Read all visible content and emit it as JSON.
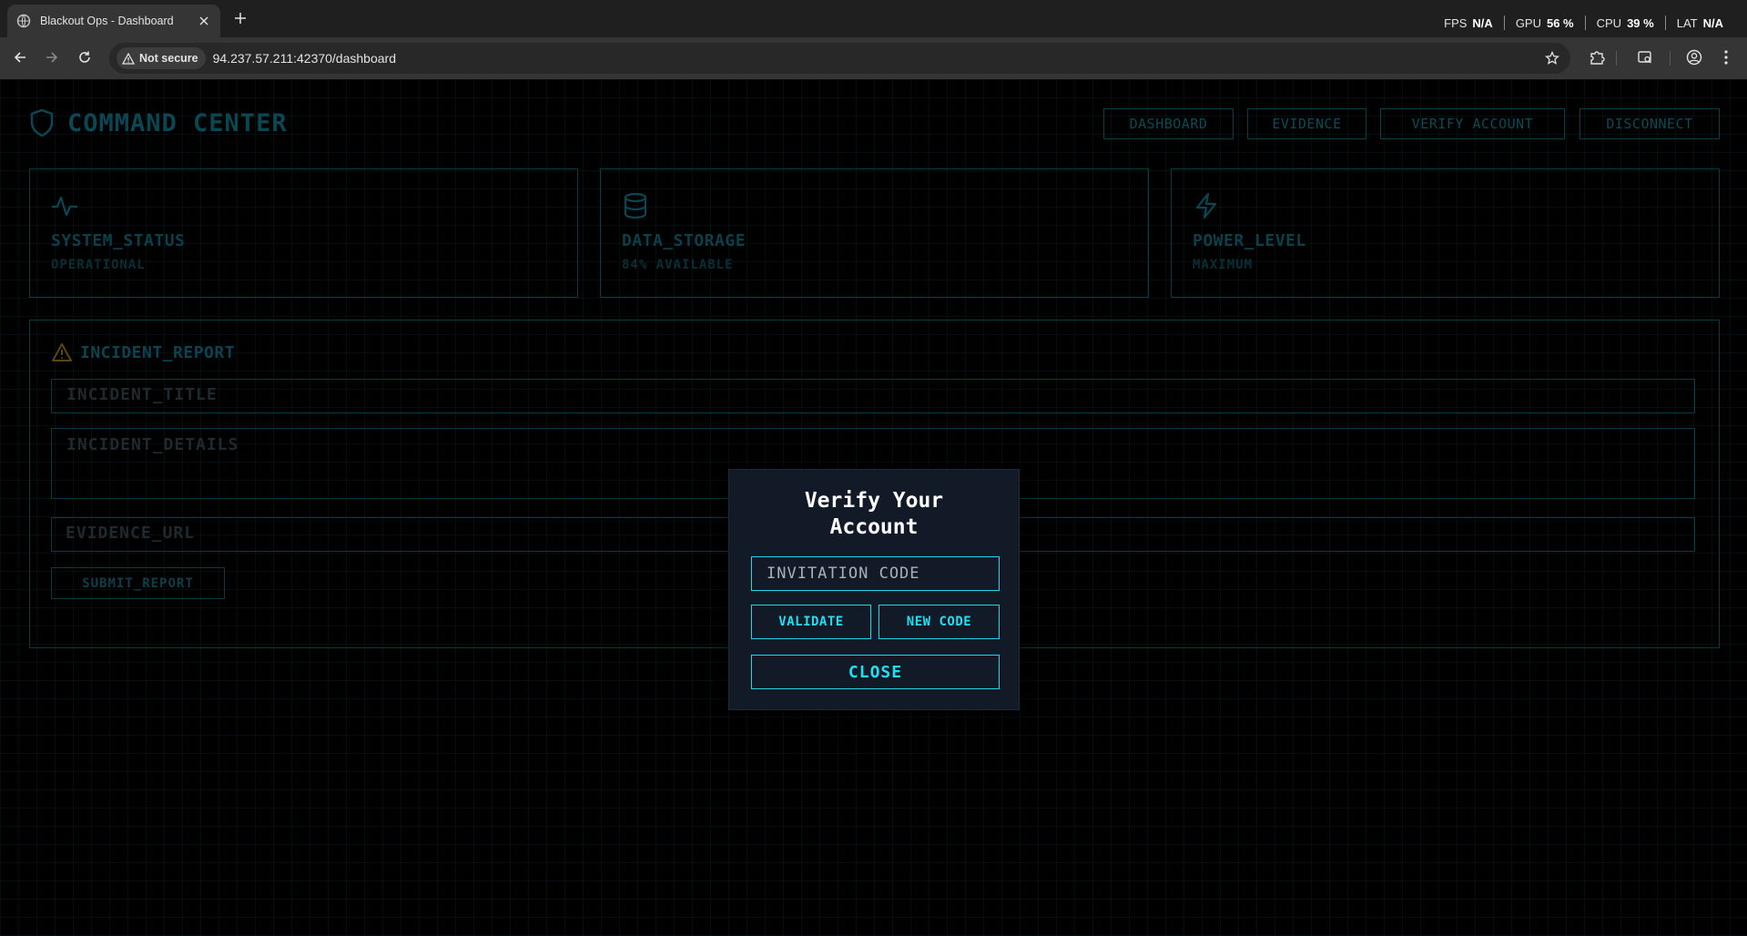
{
  "browser": {
    "tab_title": "Blackout Ops - Dashboard",
    "security_label": "Not secure",
    "url": "94.237.57.211:42370/dashboard",
    "perf": [
      {
        "label": "FPS",
        "value": "N/A"
      },
      {
        "label": "GPU",
        "value": "56 %"
      },
      {
        "label": "CPU",
        "value": "39 %"
      },
      {
        "label": "LAT",
        "value": "N/A"
      }
    ]
  },
  "header": {
    "brand": "COMMAND CENTER",
    "nav": [
      "DASHBOARD",
      "EVIDENCE",
      "VERIFY ACCOUNT",
      "DISCONNECT"
    ]
  },
  "cards": [
    {
      "icon": "activity-icon",
      "title": "SYSTEM_STATUS",
      "subtitle": "OPERATIONAL"
    },
    {
      "icon": "database-icon",
      "title": "DATA_STORAGE",
      "subtitle": "84% AVAILABLE"
    },
    {
      "icon": "zap-icon",
      "title": "POWER_LEVEL",
      "subtitle": "MAXIMUM"
    }
  ],
  "report": {
    "title": "INCIDENT_REPORT",
    "title_placeholder": "INCIDENT_TITLE",
    "details_placeholder": "INCIDENT_DETAILS",
    "evidence_placeholder": "EVIDENCE_URL",
    "submit_label": "SUBMIT_REPORT"
  },
  "modal": {
    "title": "Verify Your Account",
    "input_placeholder": "INVITATION CODE",
    "validate_label": "VALIDATE",
    "new_code_label": "NEW CODE",
    "close_label": "CLOSE"
  },
  "colors": {
    "accent": "#1ee0f2",
    "dim_accent": "#0b4753",
    "modal_bg": "#121a28",
    "warning": "#5a4410"
  }
}
